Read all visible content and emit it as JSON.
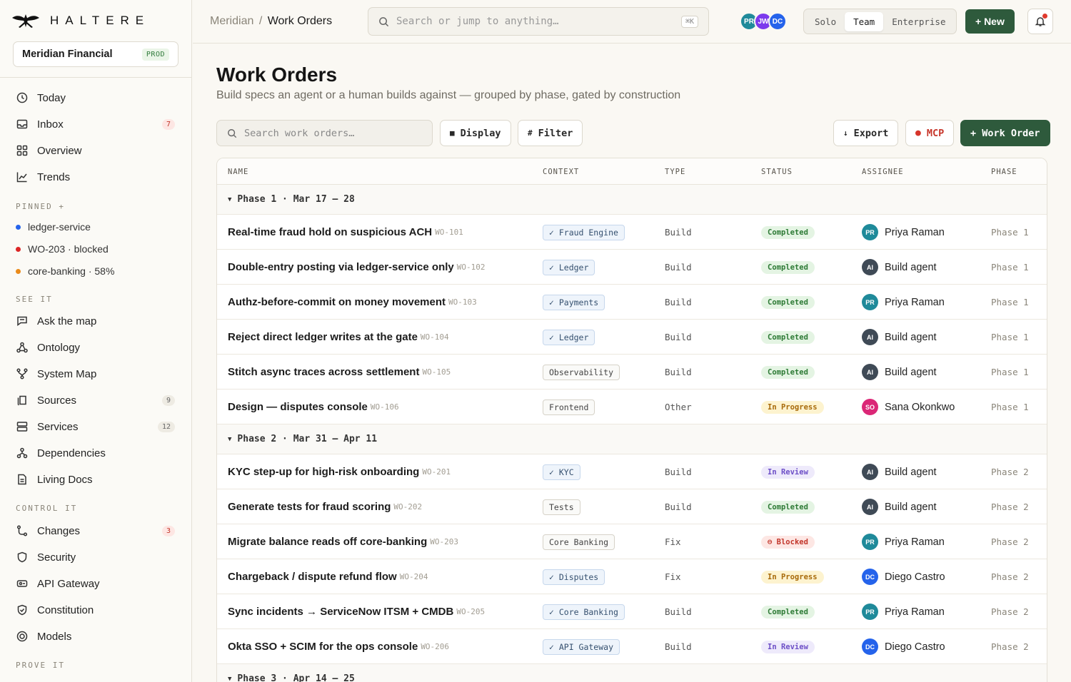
{
  "brand": {
    "name": "HALTERE"
  },
  "org": {
    "name": "Meridian Financial",
    "badge": "PROD"
  },
  "nav": {
    "today": "Today",
    "inbox": "Inbox",
    "inbox_count": "7",
    "overview": "Overview",
    "trends": "Trends",
    "pinned_label": "PINNED +",
    "pinned": [
      {
        "label": "ledger-service",
        "color": "#2563eb"
      },
      {
        "label": "WO-203 · blocked",
        "color": "#dc2626"
      },
      {
        "label": "core-banking · 58%",
        "color": "#ea8a1a"
      }
    ],
    "see_label": "SEE IT",
    "ask": "Ask the map",
    "ontology": "Ontology",
    "system_map": "System Map",
    "sources": "Sources",
    "sources_count": "9",
    "services": "Services",
    "services_count": "12",
    "dependencies": "Dependencies",
    "living_docs": "Living Docs",
    "control_label": "CONTROL IT",
    "changes": "Changes",
    "changes_count": "3",
    "security": "Security",
    "api_gateway": "API Gateway",
    "constitution": "Constitution",
    "models": "Models",
    "prove_label": "PROVE IT"
  },
  "topbar": {
    "crumb_parent": "Meridian",
    "crumb_sep": "/",
    "crumb_current": "Work Orders",
    "search_placeholder": "Search or jump to anything…",
    "search_kbd": "⌘K",
    "avatars": [
      {
        "initials": "PR",
        "color": "#1f8a9a"
      },
      {
        "initials": "JW",
        "color": "#7c3aed"
      },
      {
        "initials": "DC",
        "color": "#2563eb"
      }
    ],
    "modes": [
      "Solo",
      "Team",
      "Enterprise"
    ],
    "active_mode": "Team",
    "new_label": "+ New"
  },
  "page": {
    "title": "Work Orders",
    "subtitle": "Build specs an agent or a human builds against — grouped by phase, gated by construction"
  },
  "toolbar": {
    "search_placeholder": "Search work orders…",
    "display": "Display",
    "filter": "Filter",
    "export": "Export",
    "mcp": "MCP",
    "work_order": "+ Work Order"
  },
  "table": {
    "headers": [
      "NAME",
      "CONTEXT",
      "TYPE",
      "STATUS",
      "ASSIGNEE",
      "PHASE"
    ],
    "phases": [
      {
        "label": "Phase 1 · Mar 17 – 28",
        "rows": [
          {
            "name": "Real-time fraud hold on suspicious ACH",
            "id": "WO-101",
            "context": "✓ Fraud Engine",
            "ctx_style": "blue",
            "type": "Build",
            "status": "Completed",
            "assignee": "Priya Raman",
            "initials": "PR",
            "phase": "Phase 1"
          },
          {
            "name": "Double-entry posting via ledger-service only",
            "id": "WO-102",
            "context": "✓ Ledger",
            "ctx_style": "blue",
            "type": "Build",
            "status": "Completed",
            "assignee": "Build agent",
            "initials": "AI",
            "phase": "Phase 1"
          },
          {
            "name": "Authz-before-commit on money movement",
            "id": "WO-103",
            "context": "✓ Payments",
            "ctx_style": "blue",
            "type": "Build",
            "status": "Completed",
            "assignee": "Priya Raman",
            "initials": "PR",
            "phase": "Phase 1"
          },
          {
            "name": "Reject direct ledger writes at the gate",
            "id": "WO-104",
            "context": "✓ Ledger",
            "ctx_style": "blue",
            "type": "Build",
            "status": "Completed",
            "assignee": "Build agent",
            "initials": "AI",
            "phase": "Phase 1"
          },
          {
            "name": "Stitch async traces across settlement",
            "id": "WO-105",
            "context": "Observability",
            "ctx_style": "plain",
            "type": "Build",
            "status": "Completed",
            "assignee": "Build agent",
            "initials": "AI",
            "phase": "Phase 1"
          },
          {
            "name": "Design — disputes console",
            "id": "WO-106",
            "context": "Frontend",
            "ctx_style": "plain",
            "type": "Other",
            "status": "In Progress",
            "assignee": "Sana Okonkwo",
            "initials": "SO",
            "phase": "Phase 1"
          }
        ]
      },
      {
        "label": "Phase 2 · Mar 31 – Apr 11",
        "rows": [
          {
            "name": "KYC step-up for high-risk onboarding",
            "id": "WO-201",
            "context": "✓ KYC",
            "ctx_style": "blue",
            "type": "Build",
            "status": "In Review",
            "assignee": "Build agent",
            "initials": "AI",
            "phase": "Phase 2"
          },
          {
            "name": "Generate tests for fraud scoring",
            "id": "WO-202",
            "context": "Tests",
            "ctx_style": "plain",
            "type": "Build",
            "status": "Completed",
            "assignee": "Build agent",
            "initials": "AI",
            "phase": "Phase 2"
          },
          {
            "name": "Migrate balance reads off core-banking",
            "id": "WO-203",
            "context": "Core Banking",
            "ctx_style": "plain",
            "type": "Fix",
            "status": "Blocked",
            "assignee": "Priya Raman",
            "initials": "PR",
            "phase": "Phase 2"
          },
          {
            "name": "Chargeback / dispute refund flow",
            "id": "WO-204",
            "context": "✓ Disputes",
            "ctx_style": "blue",
            "type": "Fix",
            "status": "In Progress",
            "assignee": "Diego Castro",
            "initials": "DC",
            "phase": "Phase 2"
          },
          {
            "name": "Sync incidents → ServiceNow ITSM + CMDB",
            "id": "WO-205",
            "context": "✓ Core Banking",
            "ctx_style": "blue",
            "type": "Build",
            "status": "Completed",
            "assignee": "Priya Raman",
            "initials": "PR",
            "phase": "Phase 2"
          },
          {
            "name": "Okta SSO + SCIM for the ops console",
            "id": "WO-206",
            "context": "✓ API Gateway",
            "ctx_style": "blue",
            "type": "Build",
            "status": "In Review",
            "assignee": "Diego Castro",
            "initials": "DC",
            "phase": "Phase 2"
          }
        ]
      },
      {
        "label": "Phase 3 · Apr 14 – 25",
        "rows": []
      }
    ]
  },
  "colors": {
    "accent": "#2e5a3c",
    "completed_bg": "#e4f4e3",
    "completed_fg": "#2d7a35",
    "in_progress_bg": "#fdf3cf",
    "in_progress_fg": "#a86a0a",
    "in_review_bg": "#eeeafb",
    "in_review_fg": "#6d4fc7",
    "blocked_bg": "#fde7e4",
    "blocked_fg": "#c2352a",
    "avatar_PR": "#1f8a9a",
    "avatar_AI": "#3f4a56",
    "avatar_DC": "#2563eb",
    "avatar_SO": "#db2777"
  }
}
